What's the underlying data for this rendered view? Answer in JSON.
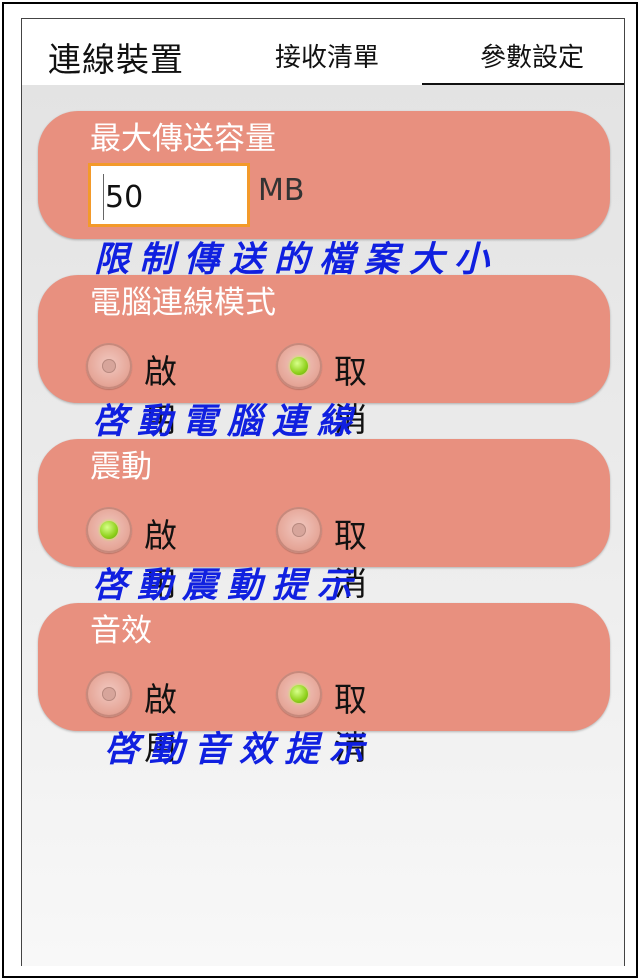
{
  "header": {
    "app_title": "連線裝置",
    "tabs": [
      {
        "label": "接收清單"
      },
      {
        "label": "參數設定"
      }
    ]
  },
  "settings": {
    "max_size": {
      "title": "最大傳送容量",
      "value": "50",
      "unit": "MB",
      "hint": "限制傳送的檔案大小"
    },
    "pc_mode": {
      "title": "電腦連線模式",
      "enable": "啟用",
      "disable": "取消",
      "selected": "取消",
      "hint": "啓動電腦連線"
    },
    "vibration": {
      "title": "震動",
      "enable": "啟用",
      "disable": "取消",
      "selected": "啟用",
      "hint": "啓動震動提示"
    },
    "sound": {
      "title": "音效",
      "enable": "啟用",
      "disable": "取消",
      "selected": "取消",
      "hint": "啓動音效提示"
    }
  },
  "colors": {
    "card": "#e8907f",
    "input_border": "#f39a2a",
    "hint_text": "#1020e0",
    "radio_checked": "#8fd11c"
  }
}
